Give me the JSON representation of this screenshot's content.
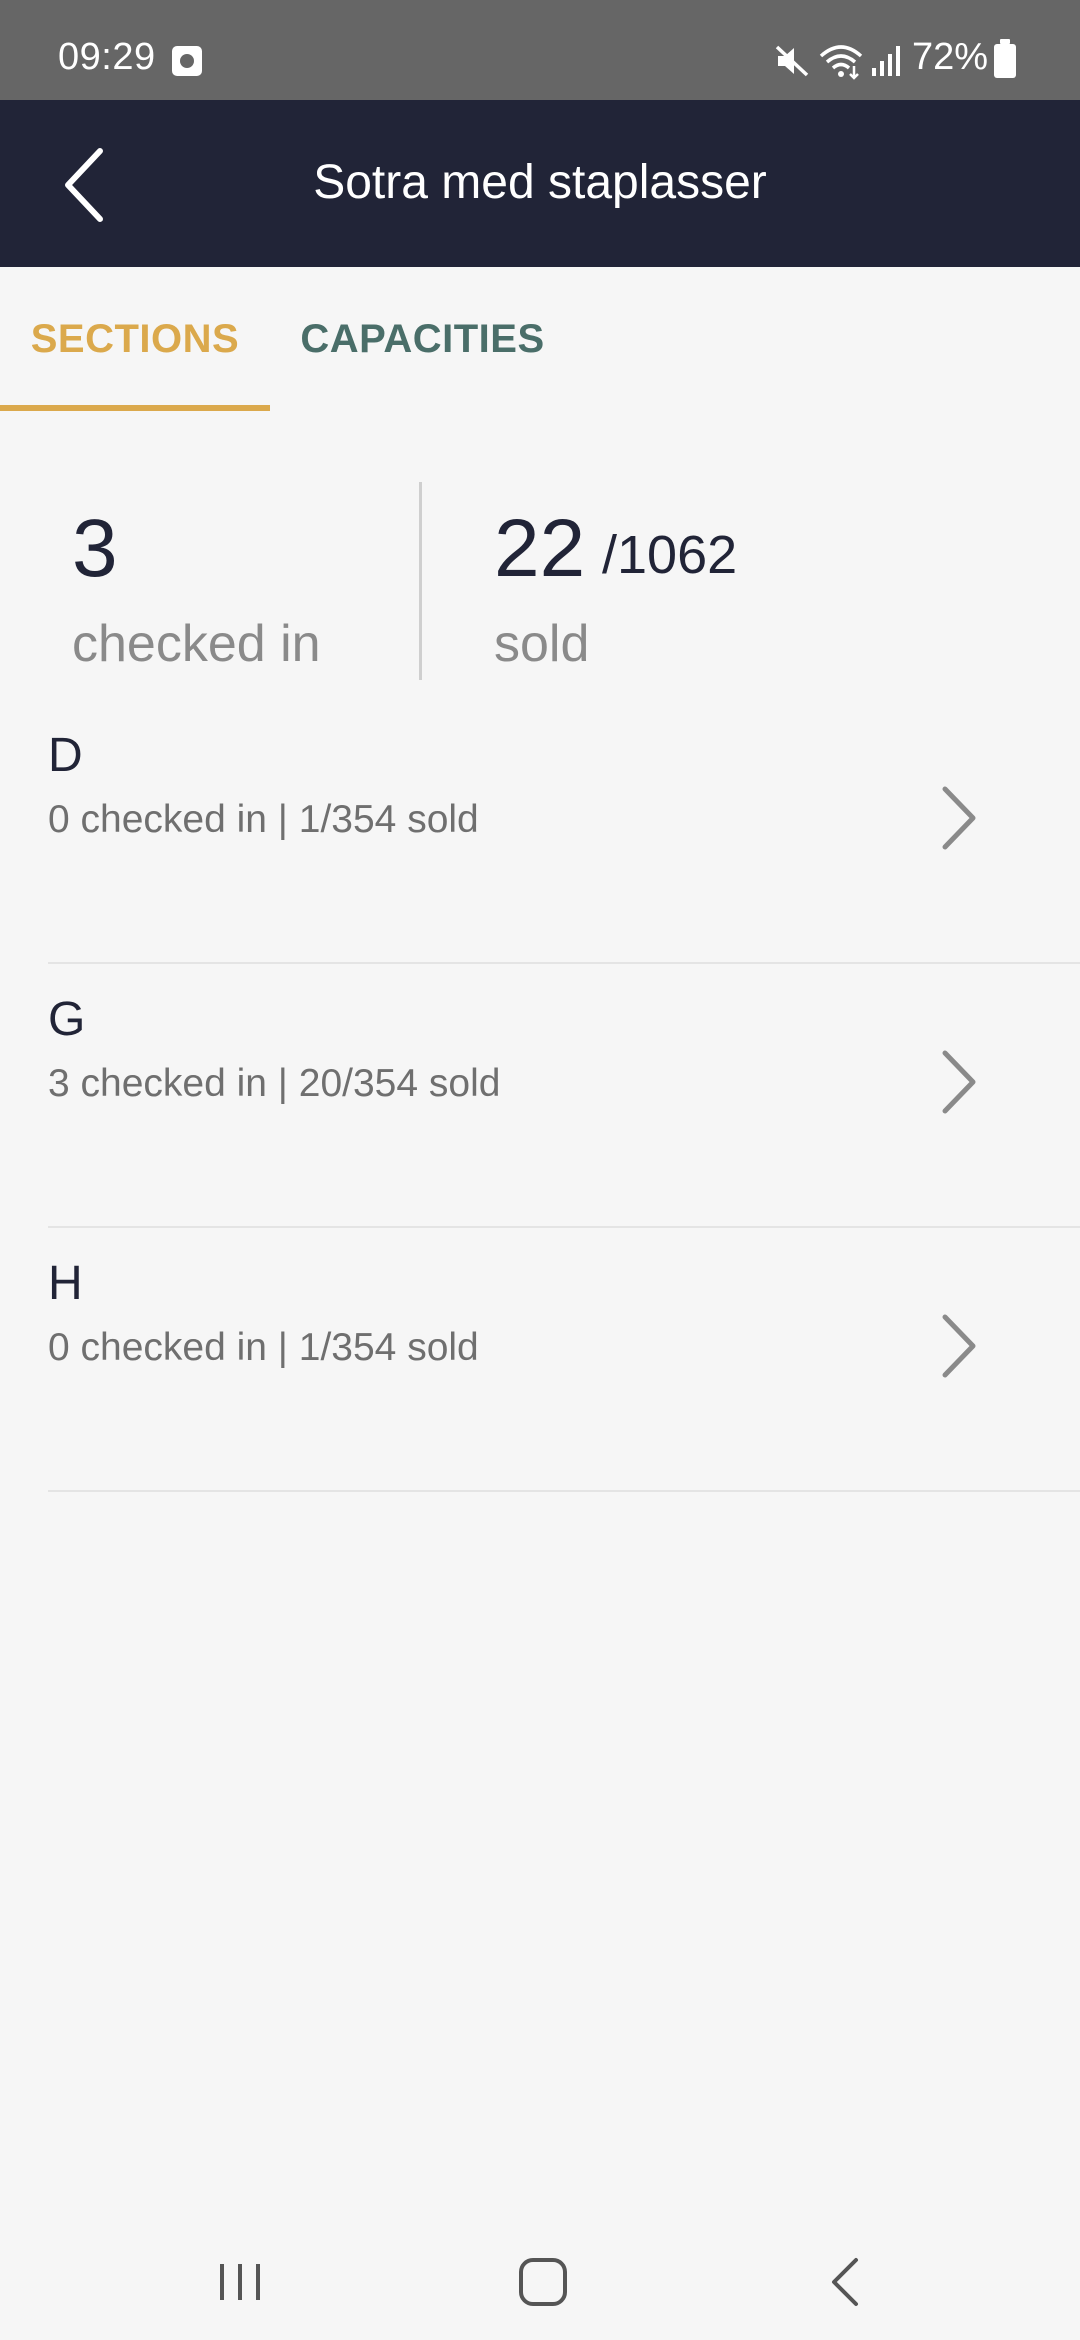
{
  "status_bar": {
    "time": "09:29",
    "battery": "72%"
  },
  "app_bar": {
    "title": "Sotra med staplasser"
  },
  "tabs": [
    {
      "label": "SECTIONS",
      "active": true
    },
    {
      "label": "CAPACITIES",
      "active": false
    }
  ],
  "summary": {
    "checked_in": "3",
    "checked_in_label": "checked in",
    "sold": "22",
    "total": "/1062",
    "sold_label": "sold"
  },
  "sections": [
    {
      "name": "D",
      "detail": "0 checked in | 1/354 sold"
    },
    {
      "name": "G",
      "detail": "3 checked in | 20/354 sold"
    },
    {
      "name": "H",
      "detail": "0 checked in | 1/354 sold"
    }
  ],
  "colors": {
    "app_bar_bg": "#212437",
    "accent": "#dba94c",
    "inactive_tab": "#4a6e69"
  }
}
